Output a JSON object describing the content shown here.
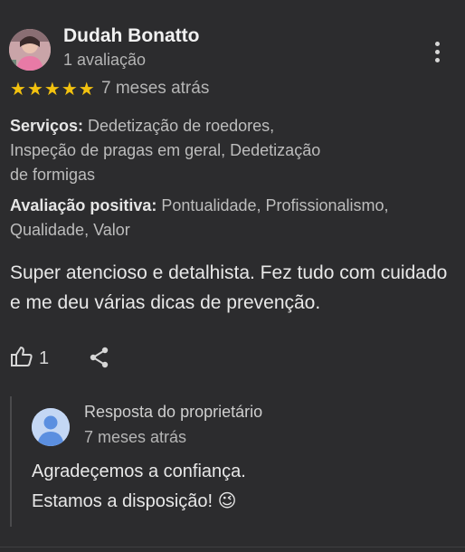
{
  "reviewer": {
    "name": "Dudah Bonatto",
    "review_count": "1 avaliação",
    "avatar_icon": "profile-photo"
  },
  "menu_icon": "more-vert-icon",
  "rating": {
    "stars": 5,
    "max": 5,
    "star_glyph": "★",
    "color": "#f3c20f"
  },
  "date": "7 meses atrás",
  "services": {
    "label": "Serviços:",
    "value": " Dedetização de roedores, Inspeção de pragas em geral, Dedetização de formigas"
  },
  "positive": {
    "label": "Avaliação positiva:",
    "value": " Pontualidade, Profissionalismo, Qualidade, Valor"
  },
  "review_text": "Super atencioso e detalhista. Fez tudo com cuidado e me deu várias dicas de prevenção.",
  "actions": {
    "like_icon": "thumbs-up-icon",
    "like_count": "1",
    "share_icon": "share-icon"
  },
  "owner_reply": {
    "title": "Resposta do proprietário",
    "date": "7 meses atrás",
    "text": "Agradeçemos a confiança.\nEstamos a disposição! 😉",
    "avatar_icon": "default-avatar-icon"
  }
}
